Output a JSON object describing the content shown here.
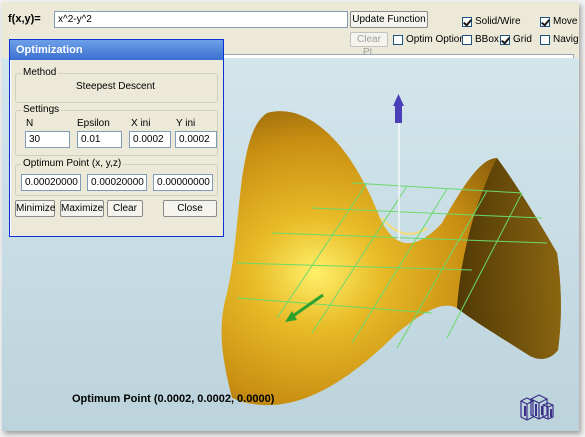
{
  "toolbar": {
    "function_label": "f(x,y)=",
    "function_value": "x^2-y^2",
    "update_button": "Update Function",
    "clear_pt_button": "Clear Pt.",
    "optim_option": {
      "label": "Optim Option",
      "checked": false
    },
    "solid_wire": {
      "label": "Solid/Wire",
      "checked": true
    },
    "bbox": {
      "label": "BBox",
      "checked": false
    },
    "grid": {
      "label": "Grid",
      "checked": true
    },
    "move": {
      "label": "Move",
      "checked": true
    },
    "navig": {
      "label": "Navig",
      "checked": false
    }
  },
  "optimization_panel": {
    "title": "Optimization",
    "method_group": "Method",
    "method_value": "Steepest Descent",
    "settings_group": "Settings",
    "settings": {
      "n": {
        "label": "N",
        "value": "30"
      },
      "epsilon": {
        "label": "Epsilon",
        "value": "0.01"
      },
      "x_ini": {
        "label": "X ini",
        "value": "0.0002"
      },
      "y_ini": {
        "label": "Y ini",
        "value": "0.0002"
      }
    },
    "optimum_group": "Optimum Point (x, y,z)",
    "optimum_values": [
      "0.00020000",
      "0.00020000",
      "0.00000000"
    ],
    "buttons": {
      "minimize": "Minimize",
      "maximize": "Maximize",
      "clear": "Clear",
      "close": "Close"
    }
  },
  "status": {
    "optimum_point": "Optimum Point (0.0002, 0.0002, 0.0000)"
  },
  "colors": {
    "surface": "#d9a419",
    "background": "#c6dbe2",
    "grid": "#6bd96b",
    "axis_arrow": "#4a3fb8",
    "titlebar": "#3a6fd0"
  }
}
